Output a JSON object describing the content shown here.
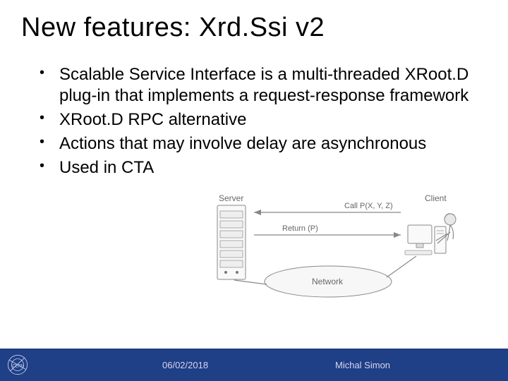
{
  "title": "New features: Xrd.Ssi v2",
  "bullets": [
    "Scalable Service Interface is a multi-threaded XRoot.D plug-in that implements a request-response framework",
    "XRoot.D RPC alternative",
    "Actions that may involve delay are asynchronous",
    "Used in CTA"
  ],
  "diagram": {
    "server_label": "Server",
    "client_label": "Client",
    "call_label": "Call P(X, Y, Z)",
    "return_label": "Return (P)",
    "network_label": "Network"
  },
  "footer": {
    "date": "06/02/2018",
    "author": "Michal Simon",
    "logo_name": "CERN"
  }
}
